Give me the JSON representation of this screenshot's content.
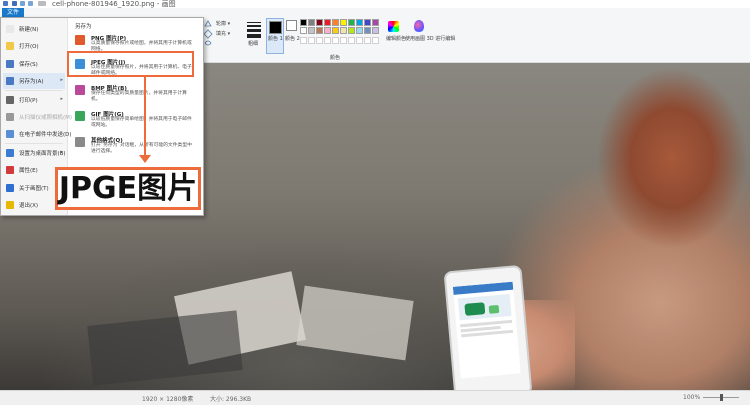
{
  "window": {
    "title": "cell-phone-801946_1920.png - 画图"
  },
  "ribbon": {
    "file_tab": "文件",
    "shapes_outline": "轮廓 ▾",
    "shapes_fill": "填充 ▾",
    "size_label": "粗细",
    "color1_label": "颜色 1",
    "color2_label": "颜色 2",
    "edit_colors_label": "编辑颜色",
    "paint3d_label": "使用画图 3D 进行编辑",
    "colors_group": "颜色",
    "palette": [
      "#000000",
      "#7f7f7f",
      "#880015",
      "#ed1c24",
      "#ff7f27",
      "#fff200",
      "#22b14c",
      "#00a2e8",
      "#3f48cc",
      "#a349a4",
      "#ffffff",
      "#c3c3c3",
      "#b97a57",
      "#ffaec9",
      "#ffc90e",
      "#efe4b0",
      "#b5e61d",
      "#99d9ea",
      "#7092be",
      "#c8bfe7"
    ]
  },
  "file_menu": {
    "items": [
      {
        "label": "新建(N)",
        "color": "#e8e8e8"
      },
      {
        "label": "打开(O)",
        "color": "#f0c94a"
      },
      {
        "label": "保存(S)",
        "color": "#4a78c2"
      },
      {
        "label": "另存为(A)",
        "color": "#4a78c2",
        "arrow": "▸"
      },
      {
        "label": "打印(P)",
        "color": "#666666",
        "arrow": "▸"
      },
      {
        "label": "从扫描仪或照相机(M)",
        "color": "#999999"
      },
      {
        "label": "在电子邮件中发送(D)",
        "color": "#5a8fd6"
      },
      {
        "label": "设置为桌面背景(B)",
        "color": "#3b7bd1",
        "arrow": "▸"
      },
      {
        "label": "属性(E)",
        "color": "#d23b3b"
      },
      {
        "label": "关于画图(T)",
        "color": "#2f6fd0"
      },
      {
        "label": "退出(X)",
        "color": "#e6b800"
      }
    ],
    "saveas_heading": "另存为",
    "saveas_options": [
      {
        "title": "PNG 图片(P)",
        "desc": "以高质量保存照片或绘图，并将其用于计算机或网络。",
        "color": "#e05a2a"
      },
      {
        "title": "JPEG 图片(J)",
        "desc": "以较佳质量保存照片，并将其用于计算机、电子邮件或网络。",
        "color": "#3a8fd6"
      },
      {
        "title": "BMP 图片(B)",
        "desc": "保存任何类型的高质量图片，并将其用于计算机。",
        "color": "#b94a9a"
      },
      {
        "title": "GIF 图片(G)",
        "desc": "以较低质量保存简单绘图，并将其用于电子邮件或网站。",
        "color": "#3aa65a"
      },
      {
        "title": "其他格式(O)",
        "desc": "打开“另存为”对话框，从所有可能的文件类型中进行选择。",
        "color": "#8a8a8a"
      }
    ]
  },
  "annotation": {
    "callout": "JPGE图片",
    "highlight_color": "#ee6b3c"
  },
  "status": {
    "dimensions": "1920 × 1280像素",
    "size": "大小: 296.3KB",
    "zoom": "100%"
  }
}
